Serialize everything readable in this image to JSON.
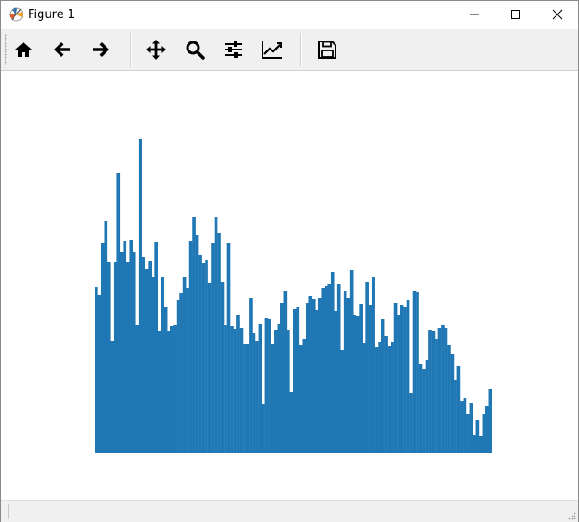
{
  "window": {
    "title": "Figure 1",
    "controls": [
      "minimize-icon",
      "maximize-icon",
      "close-icon"
    ]
  },
  "toolbar": {
    "buttons": [
      {
        "name": "home",
        "icon": "home-icon"
      },
      {
        "name": "back",
        "icon": "arrow-left-icon"
      },
      {
        "name": "forward",
        "icon": "arrow-right-icon"
      },
      {
        "name": "pan",
        "icon": "move-icon"
      },
      {
        "name": "zoom",
        "icon": "search-icon"
      },
      {
        "name": "configure-subplots",
        "icon": "sliders-icon"
      },
      {
        "name": "edit-axes",
        "icon": "chart-line-icon"
      },
      {
        "name": "save",
        "icon": "floppy-disk-icon"
      }
    ]
  },
  "status": {
    "text": ""
  },
  "colors": {
    "bar": "#1f77b4",
    "toolbar": "#f0f0f0"
  },
  "chart_data": {
    "type": "bar",
    "title": "",
    "xlabel": "",
    "ylabel": "",
    "axes_visible": false,
    "grid": false,
    "ylim": [
      0,
      350
    ],
    "values": [
      185,
      176,
      234,
      258,
      212,
      125,
      212,
      311,
      224,
      236,
      212,
      237,
      223,
      142,
      349,
      218,
      205,
      214,
      196,
      235,
      136,
      196,
      162,
      136,
      141,
      142,
      170,
      178,
      196,
      184,
      236,
      262,
      242,
      220,
      211,
      215,
      189,
      233,
      262,
      245,
      190,
      142,
      234,
      141,
      138,
      154,
      139,
      121,
      121,
      173,
      134,
      125,
      144,
      55,
      150,
      149,
      121,
      137,
      144,
      167,
      180,
      137,
      68,
      160,
      163,
      120,
      127,
      167,
      175,
      171,
      159,
      172,
      184,
      186,
      188,
      201,
      158,
      188,
      115,
      180,
      173,
      204,
      154,
      152,
      166,
      122,
      190,
      165,
      196,
      118,
      124,
      149,
      130,
      119,
      124,
      167,
      154,
      165,
      162,
      170,
      67,
      180,
      179,
      99,
      94,
      104,
      137,
      136,
      127,
      139,
      143,
      139,
      120,
      110,
      81,
      97,
      58,
      62,
      44,
      56,
      21,
      37,
      19,
      44,
      53,
      72
    ]
  }
}
